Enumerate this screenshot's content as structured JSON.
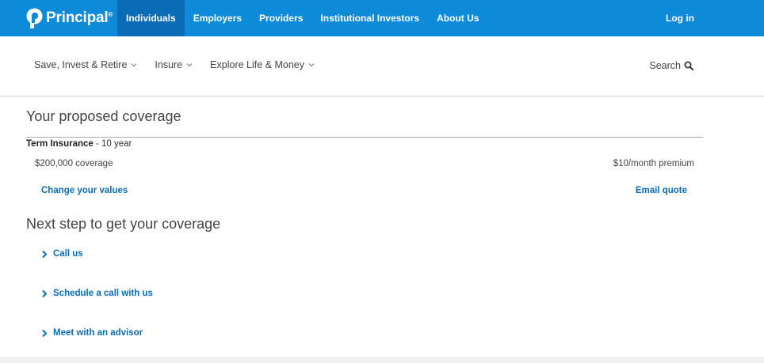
{
  "brand": {
    "name": "Principal",
    "mark": "®",
    "logo_icon": "principal-logo-icon"
  },
  "topnav": {
    "items": [
      {
        "label": "Individuals",
        "active": true
      },
      {
        "label": "Employers",
        "active": false
      },
      {
        "label": "Providers",
        "active": false
      },
      {
        "label": "Institutional Investors",
        "active": false
      },
      {
        "label": "About Us",
        "active": false
      }
    ],
    "login_label": "Log in"
  },
  "subnav": {
    "items": [
      {
        "label": "Save, Invest & Retire",
        "icon": "chevron-down-icon"
      },
      {
        "label": "Insure",
        "icon": "chevron-down-icon"
      },
      {
        "label": "Explore Life & Money",
        "icon": "chevron-down-icon"
      }
    ],
    "search_label": "Search",
    "search_icon": "search-icon"
  },
  "coverage": {
    "heading": "Your proposed coverage",
    "product": "Term Insurance",
    "term": " - 10 year",
    "amount": "$200,000 coverage",
    "premium": "$10/month premium",
    "change_link": "Change your values",
    "email_link": "Email quote"
  },
  "next_steps": {
    "heading": "Next step to get your coverage",
    "actions": [
      {
        "label": "Call us",
        "icon": "chevron-right-icon"
      },
      {
        "label": "Schedule a call with us",
        "icon": "chevron-right-icon"
      },
      {
        "label": "Meet with an advisor",
        "icon": "chevron-right-icon"
      }
    ]
  },
  "colors": {
    "brand_blue": "#0d8bd8",
    "active_blue": "#0a6cb6",
    "link_blue": "#0a6cb6"
  }
}
